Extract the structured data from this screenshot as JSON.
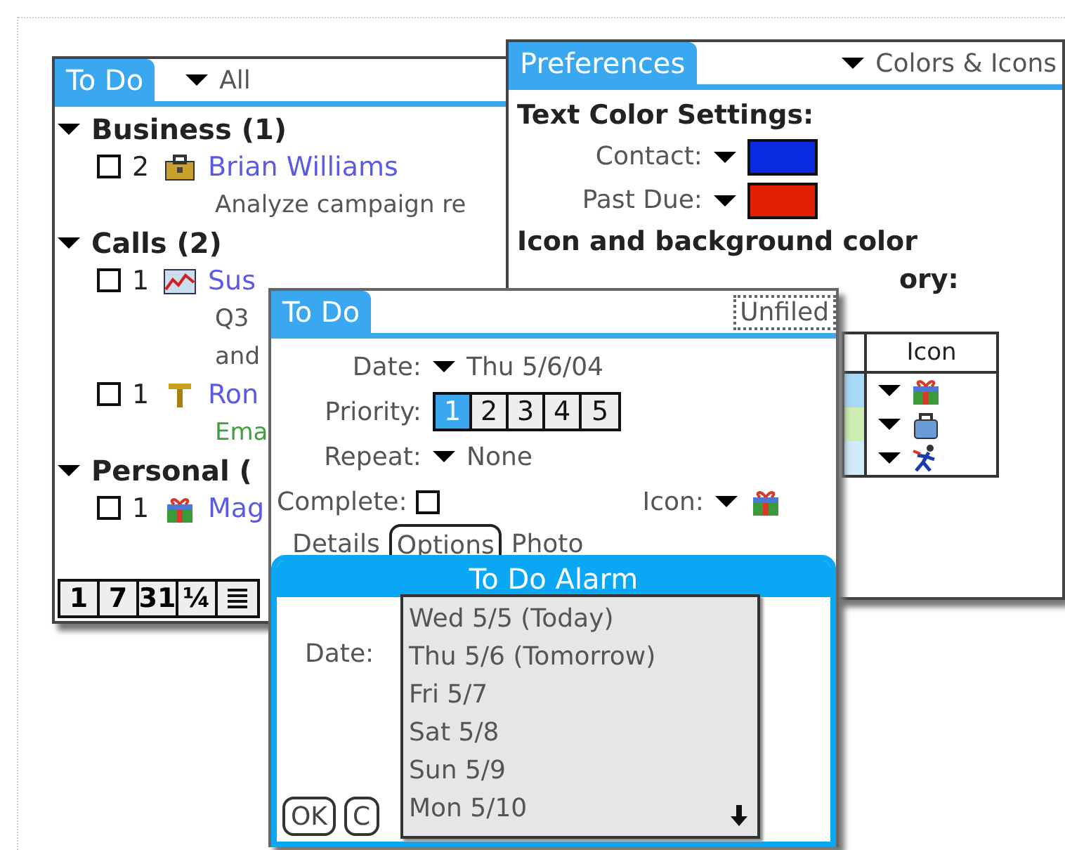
{
  "todo_list": {
    "title": "To Do",
    "category": "All",
    "groups": [
      {
        "name": "Business (1)",
        "expanded": true,
        "items": [
          {
            "checked": false,
            "priority": "2",
            "kind": "briefcase",
            "title": "Brian Williams",
            "notes": [
              {
                "text": "Analyze campaign re",
                "color": "#555555"
              }
            ]
          }
        ]
      },
      {
        "name": "Calls (2)",
        "expanded": true,
        "items": [
          {
            "checked": false,
            "priority": "1",
            "kind": "chart",
            "title": "Sus",
            "notes": [
              {
                "text": "Q3",
                "color": "#555555"
              },
              {
                "text": "and",
                "color": "#555555"
              }
            ]
          },
          {
            "checked": false,
            "priority": "1",
            "kind": "tee",
            "title": "Ron",
            "notes": [
              {
                "text": "Ema",
                "color": "#3fa03f"
              }
            ]
          }
        ]
      },
      {
        "name": "Personal (",
        "expanded": true,
        "items": [
          {
            "checked": false,
            "priority": "1",
            "kind": "gift",
            "title": "Mag"
          }
        ]
      }
    ],
    "toolbar": [
      {
        "kind": "text",
        "label": "1"
      },
      {
        "kind": "text",
        "label": "7"
      },
      {
        "kind": "text",
        "label": "31"
      },
      {
        "kind": "text",
        "label": "¼"
      },
      {
        "kind": "list"
      }
    ]
  },
  "preferences": {
    "title": "Preferences",
    "category": "Colors & Icons",
    "heading": "Text Color Settings:",
    "text_colors": [
      {
        "label": "Contact:",
        "color": "#0a2be0"
      },
      {
        "label": "Past Due:",
        "color": "#e02000"
      }
    ],
    "paragraph": "Icon and background color",
    "paragraph_tail": "ory:",
    "table": {
      "columns": [
        "Icon"
      ],
      "rows": [
        {
          "color": "#a9d9f7",
          "kind": "gift"
        },
        {
          "color": "#cdeeb0",
          "kind": "bag"
        },
        {
          "color": "#cfebfb",
          "kind": "runner"
        }
      ]
    }
  },
  "todo_detail": {
    "title": "To Do",
    "category": "Unfiled",
    "date_label": "Date:",
    "date": "Thu 5/6/04",
    "priority_label": "Priority:",
    "priorities": [
      {
        "label": "1",
        "selected": true
      },
      {
        "label": "2",
        "selected": false
      },
      {
        "label": "3",
        "selected": false
      },
      {
        "label": "4",
        "selected": false
      },
      {
        "label": "5",
        "selected": false
      }
    ],
    "repeat_label": "Repeat:",
    "repeat": "None",
    "complete_label": "Complete:",
    "complete": false,
    "icon_label": "Icon:",
    "tabs": [
      {
        "label": "Details",
        "selected": false
      },
      {
        "label": "Options",
        "selected": true
      },
      {
        "label": "Photo",
        "selected": false
      }
    ]
  },
  "alarm": {
    "title": "To Do Alarm",
    "date_label": "Date:",
    "dates": [
      "Wed 5/5 (Today)",
      "Thu 5/6 (Tomorrow)",
      "Fri 5/7",
      "Sat 5/8",
      "Sun 5/9",
      "Mon 5/10"
    ],
    "buttons": [
      "OK",
      "C"
    ]
  }
}
